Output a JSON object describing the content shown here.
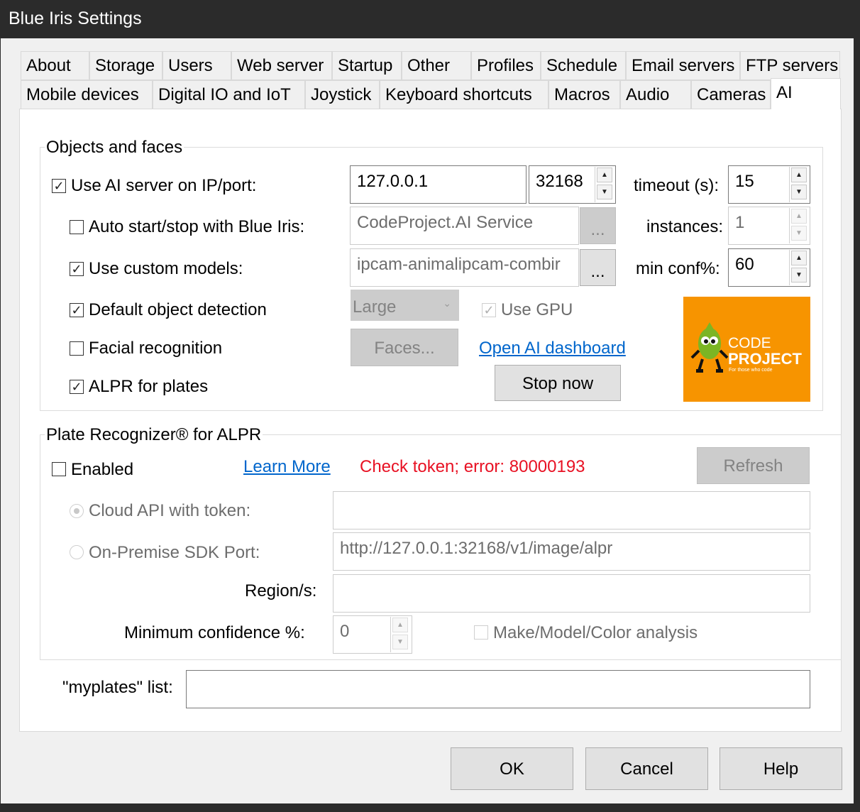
{
  "window": {
    "title": "Blue Iris Settings"
  },
  "tabs_row1": [
    "About",
    "Storage",
    "Users",
    "Web server",
    "Startup",
    "Other",
    "Profiles",
    "Schedule",
    "Email servers",
    "FTP servers"
  ],
  "tabs_row2": [
    "Mobile devices",
    "Digital IO and IoT",
    "Joystick",
    "Keyboard shortcuts",
    "Macros",
    "Audio",
    "Cameras",
    "AI"
  ],
  "objects_faces": {
    "title": "Objects and faces",
    "use_ai_server": {
      "label": "Use AI server on IP/port:",
      "checked": true
    },
    "ip": "127.0.0.1",
    "port": "32168",
    "timeout_label": "timeout (s):",
    "timeout": "15",
    "auto_start": {
      "label": "Auto start/stop with Blue Iris:",
      "checked": false
    },
    "service": "CodeProject.AI Service",
    "browse_label": "...",
    "instances_label": "instances:",
    "instances": "1",
    "custom_models": {
      "label": "Use custom models:",
      "checked": true
    },
    "models": "ipcam-animalipcam-combir",
    "min_conf_label": "min conf%:",
    "min_conf": "60",
    "default_detection": {
      "label": "Default object detection",
      "checked": true
    },
    "model_size": "Large",
    "use_gpu": {
      "label": "Use GPU",
      "checked": true
    },
    "facial": {
      "label": "Facial recognition",
      "checked": false
    },
    "faces_button": "Faces...",
    "dashboard_link": "Open AI dashboard",
    "alpr": {
      "label": "ALPR for plates",
      "checked": true
    },
    "stop_button": "Stop now",
    "logo": {
      "line1": "CODE",
      "line2": "PROJECT",
      "tagline": "For those who code",
      "color": "#f79400"
    }
  },
  "plate_recognizer": {
    "title": "Plate Recognizer® for ALPR",
    "enabled": {
      "label": "Enabled",
      "checked": false
    },
    "learn_more": "Learn More",
    "status": "Check token; error: 80000193",
    "status_color": "#e81123",
    "refresh": "Refresh",
    "cloud_label": "Cloud API with token:",
    "cloud_token": "",
    "onprem_label": "On-Premise SDK Port:",
    "onprem_url": "http://127.0.0.1:32168/v1/image/alpr",
    "region_label": "Region/s:",
    "region": "",
    "min_conf_label": "Minimum confidence %:",
    "min_conf": "0",
    "mmc": {
      "label": "Make/Model/Color analysis",
      "checked": false
    }
  },
  "myplates": {
    "label": "\"myplates\" list:",
    "value": ""
  },
  "buttons": {
    "ok": "OK",
    "cancel": "Cancel",
    "help": "Help"
  }
}
